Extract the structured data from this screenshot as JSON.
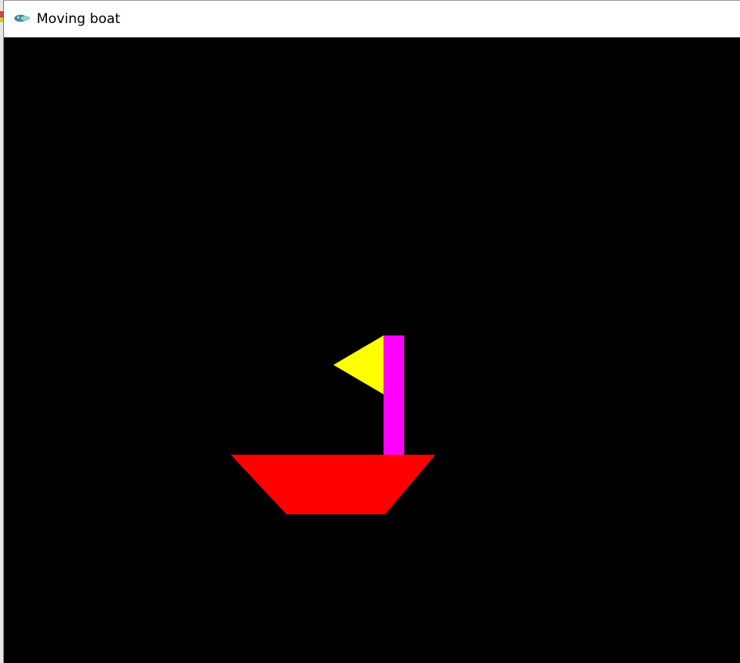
{
  "window": {
    "title": "Moving boat",
    "icon": "python-feather-icon"
  },
  "scene": {
    "background": "#000000",
    "boat": {
      "hull_color": "#ff0000",
      "mast_color": "#ff00ff",
      "flag_color": "#ffff00"
    }
  }
}
